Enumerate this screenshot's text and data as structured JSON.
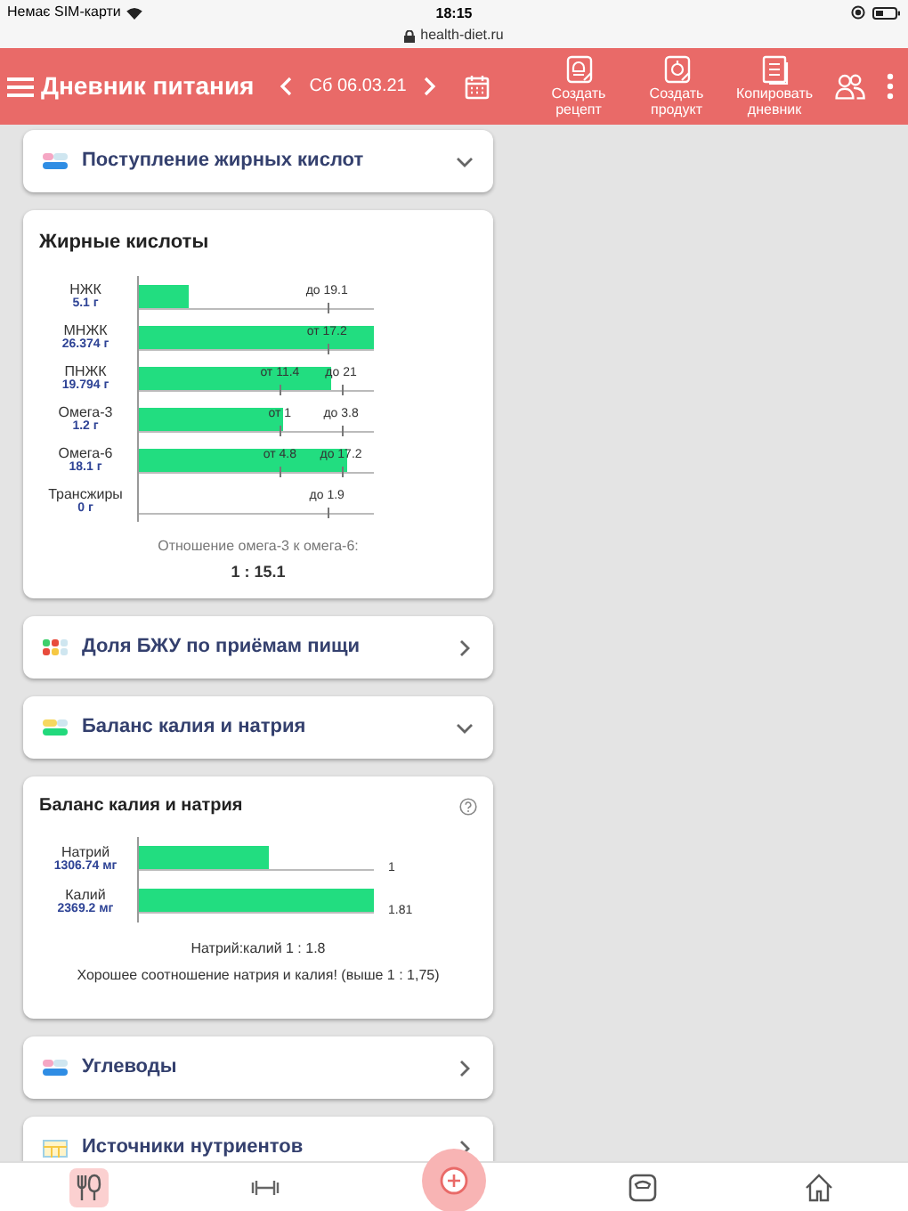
{
  "status_bar": {
    "carrier": "Немає SIM-карти",
    "time": "18:15",
    "url": "health-diet.ru"
  },
  "header": {
    "title": "Дневник питания",
    "date": "Сб 06.03.21",
    "actions": [
      {
        "label": "Создать рецепт",
        "kind": "recipe"
      },
      {
        "label": "Создать продукт",
        "kind": "product"
      },
      {
        "label": "Копировать дневник",
        "kind": "copy"
      }
    ]
  },
  "sections": [
    {
      "kind": "section",
      "title": "Поступление жирных кислот",
      "expanded": true
    },
    {
      "kind": "fats_card",
      "title": "Жирные кислоты",
      "rows": [
        {
          "name": "НЖК",
          "amount": "5.1 г",
          "level": 0.21,
          "marks": [
            "до 19.1"
          ]
        },
        {
          "name": "МНЖК",
          "amount": "26.374 г",
          "level": 1,
          "marks": [
            "от 17.2"
          ]
        },
        {
          "name": "ПНЖК",
          "amount": "19.794 г",
          "level": 0.82,
          "marks": [
            "от 11.4",
            "до 21"
          ]
        },
        {
          "name": "Омега-3",
          "amount": "1.2 г",
          "level": 0.61,
          "marks": [
            "от 1",
            "до 3.8"
          ]
        },
        {
          "name": "Омега-6",
          "amount": "18.1 г",
          "level": 0.89,
          "marks": [
            "от 4.8",
            "до 17.2"
          ]
        },
        {
          "name": "Трансжиры",
          "amount": "0 г",
          "level": 0,
          "marks": [
            "до 1.9"
          ]
        }
      ],
      "ratio_label": "Отношение омега-3 к омега-6:",
      "ratio": "1 : 15.1"
    },
    {
      "kind": "section",
      "title": "Доля БЖУ по приёмам пищи",
      "expanded": false
    },
    {
      "kind": "section",
      "title": "Баланс калия и натрия",
      "expanded": true
    },
    {
      "kind": "balance_card",
      "title": "Баланс калия и натрия",
      "rows": [
        {
          "name": "Натрий",
          "amount": "1306.74 мг",
          "level": 0.55,
          "value": "1"
        },
        {
          "name": "Калий",
          "amount": "2369.2 мг",
          "level": 1,
          "value": "1.81"
        }
      ],
      "ratio": "Натрий:калий 1 : 1.8",
      "note": "Хорошее соотношение натрия и калия! (выше 1 : 1,75)"
    },
    {
      "kind": "section",
      "title": "Углеводы",
      "expanded": false
    },
    {
      "kind": "section",
      "title": "Источники нутриентов",
      "expanded": false
    }
  ],
  "bottom_nav": [
    {
      "selected": true
    },
    {
      "selected": false
    },
    {
      "selected": false
    },
    {
      "selected": false
    },
    {
      "selected": false
    }
  ]
}
